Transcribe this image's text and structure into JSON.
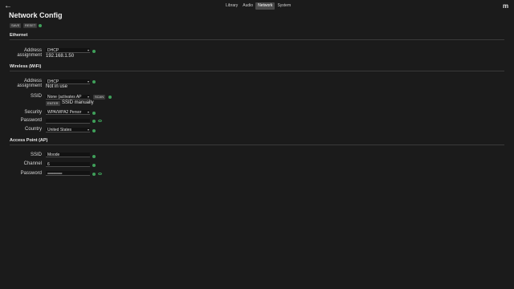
{
  "nav": {
    "back_icon": "arrow-left-icon",
    "tabs": [
      {
        "label": "Library"
      },
      {
        "label": "Audio"
      },
      {
        "label": "Network"
      },
      {
        "label": "System"
      }
    ],
    "active_tab": "Network",
    "logo": "m"
  },
  "page": {
    "title": "Network Config",
    "save_label": "SAVE",
    "reset_label": "RESET"
  },
  "ethernet": {
    "heading": "Ethernet",
    "address_label_1": "Address",
    "address_label_2": "assignment",
    "address_value": "DHCP",
    "ip": "192.168.1.50"
  },
  "wireless": {
    "heading": "Wireless (WiFi)",
    "address_label_1": "Address",
    "address_label_2": "assignment",
    "address_value": "DHCP",
    "status": "Not in use",
    "ssid_label": "SSID",
    "ssid_value": "None (activates AP",
    "scan_label": "SCAN",
    "enter_label": "ENTER",
    "manual_label": "SSID manually",
    "security_label": "Security",
    "security_value": "WPA/WPA2 Persor",
    "password_label": "Password",
    "password_value": "",
    "country_label": "Country",
    "country_value": "United States"
  },
  "ap": {
    "heading": "Access Point (AP)",
    "ssid_label": "SSID",
    "ssid_value": "Moode",
    "channel_label": "Channel",
    "channel_value": "6",
    "password_label": "Password",
    "password_value": "••••••••••••••••••••"
  },
  "colors": {
    "background": "#1b1b1b",
    "accent_green": "#3fa05a",
    "active_tab": "#4a4a4a"
  }
}
